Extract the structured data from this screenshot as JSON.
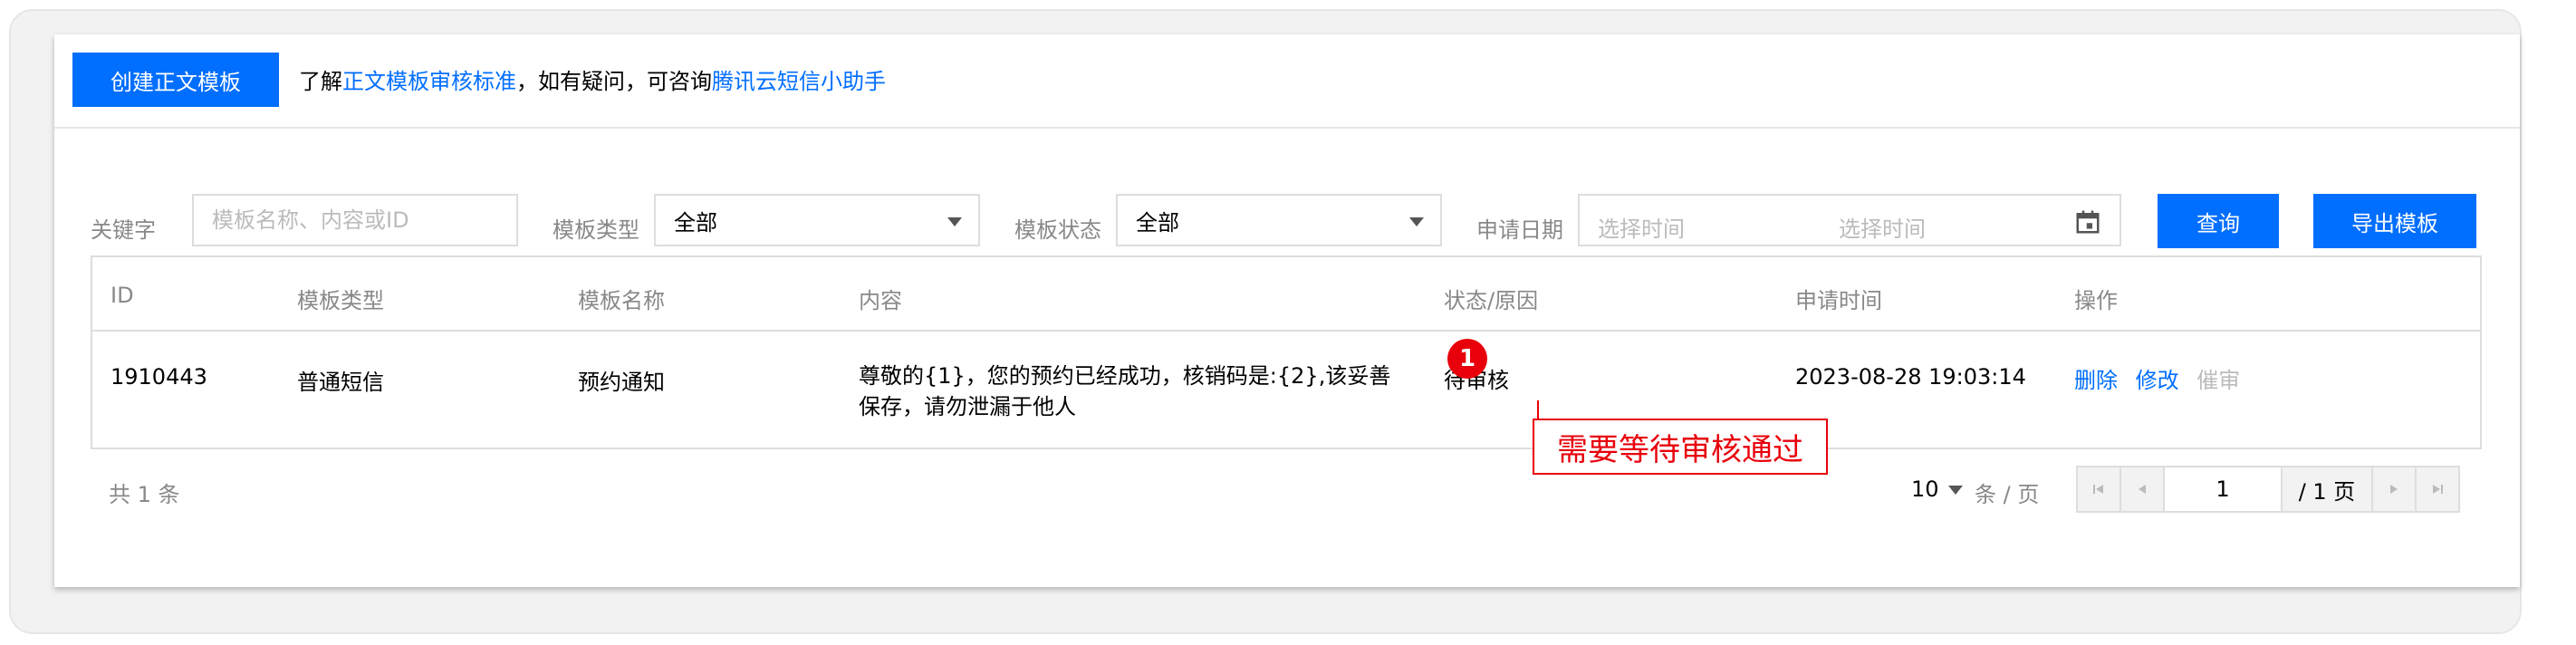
{
  "toolbar": {
    "create_label": "创建正文模板",
    "tip_prefix": "了解",
    "tip_link_standard": "正文模板审核标准",
    "tip_middle": "，如有疑问，可咨询",
    "tip_link_assistant": "腾讯云短信小助手"
  },
  "filters": {
    "keyword_label": "关键字",
    "keyword_placeholder": "模板名称、内容或ID",
    "type_label": "模板类型",
    "type_value": "全部",
    "status_label": "模板状态",
    "status_value": "全部",
    "date_label": "申请日期",
    "date_start_placeholder": "选择时间",
    "date_end_placeholder": "选择时间",
    "query_label": "查询",
    "export_label": "导出模板"
  },
  "table": {
    "headers": [
      "ID",
      "模板类型",
      "模板名称",
      "内容",
      "状态/原因",
      "申请时间",
      "操作"
    ],
    "rows": [
      {
        "id": "1910443",
        "type": "普通短信",
        "name": "预约通知",
        "content": "尊敬的{1}，您的预约已经成功，核销码是:{2},该妥善保存，请勿泄漏于他人",
        "status": "待审核",
        "time": "2023-08-28 19:03:14",
        "op_delete": "删除",
        "op_edit": "修改",
        "op_urge": "催审"
      }
    ]
  },
  "annotation": {
    "badge": "1",
    "note": "需要等待审核通过"
  },
  "pagination": {
    "total": "共 1 条",
    "page_size": "10",
    "page_unit": "条 / 页",
    "current_page": "1",
    "total_pages": "/ 1 页"
  },
  "colors": {
    "primary": "#006eff",
    "annotation": "#e8000b"
  },
  "icons": [
    "calendar-icon",
    "chevron-down-icon",
    "first-page-icon",
    "prev-page-icon",
    "next-page-icon",
    "last-page-icon"
  ]
}
